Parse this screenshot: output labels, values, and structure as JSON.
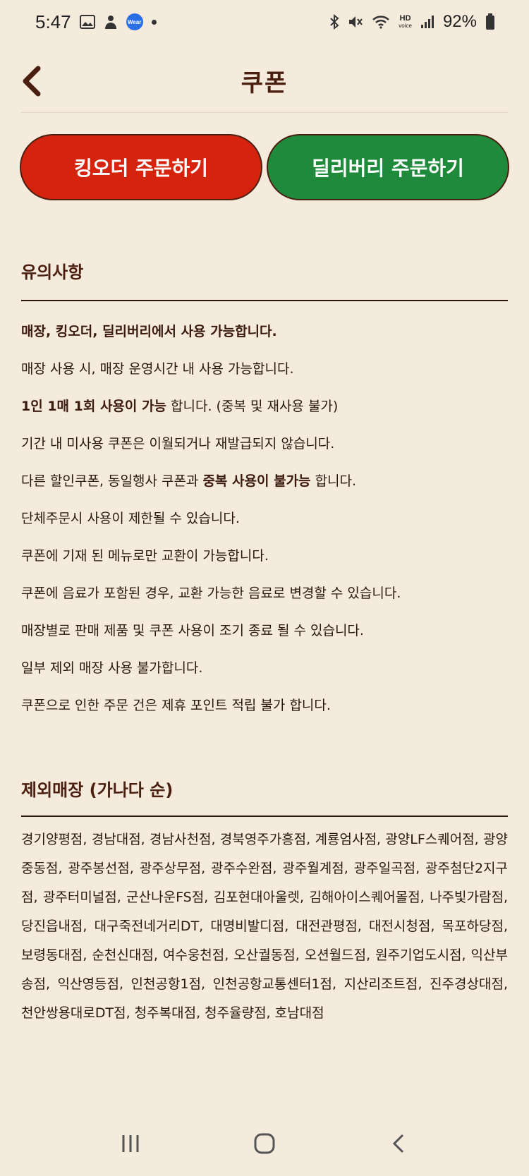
{
  "status_bar": {
    "time": "5:47",
    "wear_label": "Wear",
    "hd_label": "HD",
    "voice_label": "voice",
    "battery": "92%"
  },
  "header": {
    "title": "쿠폰"
  },
  "buttons": {
    "king_order": "킹오더 주문하기",
    "delivery_order": "딜리버리 주문하기",
    "red": "#d6230d",
    "green": "#1f8a3b"
  },
  "notice": {
    "title": "유의사항",
    "items": [
      {
        "bold": "매장, 킹오더, 딜리버리에서 사용 가능합니다.",
        "text": ""
      },
      {
        "text": "매장 사용 시, 매장 운영시간 내 사용 가능합니다."
      },
      {
        "bold": "1인 1매 1회 사용이 가능",
        "text": " 합니다. (중복 및 재사용 불가)"
      },
      {
        "text": "기간 내 미사용 쿠폰은 이월되거나 재발급되지 않습니다."
      },
      {
        "pre": "다른 할인쿠폰, 동일행사 쿠폰과 ",
        "bold": "중복 사용이 불가능",
        "text": " 합니다."
      },
      {
        "text": "단체주문시 사용이 제한될 수 있습니다."
      },
      {
        "text": "쿠폰에 기재 된 메뉴로만 교환이 가능합니다."
      },
      {
        "text": "쿠폰에 음료가 포함된 경우, 교환 가능한 음료로 변경할 수 있습니다."
      },
      {
        "text": "매장별로 판매 제품 및 쿠폰 사용이 조기 종료 될 수 있습니다."
      },
      {
        "text": "일부 제외 매장 사용 불가합니다."
      },
      {
        "text": "쿠폰으로 인한 주문 건은 제휴 포인트 적립 불가 합니다."
      }
    ]
  },
  "excluded": {
    "title": "제외매장 (가나다 순)",
    "stores": "경기양평점, 경남대점, 경남사천점, 경북영주가흥점, 계룡엄사점, 광양LF스퀘어점, 광양중동점, 광주봉선점, 광주상무점, 광주수완점, 광주월계점, 광주일곡점, 광주첨단2지구점, 광주터미널점, 군산나운FS점, 김포현대아울렛, 김해아이스퀘어몰점, 나주빛가람점, 당진읍내점, 대구죽전네거리DT, 대명비발디점, 대전관평점, 대전시청점, 목포하당점, 보령동대점, 순천신대점, 여수웅천점, 오산궐동점, 오션월드점, 원주기업도시점, 익산부송점, 익산영등점, 인천공항1점, 인천공항교통센터1점, 지산리조트점, 진주경상대점, 천안쌍용대로DT점, 청주복대점, 청주율량점, 호남대점"
  }
}
